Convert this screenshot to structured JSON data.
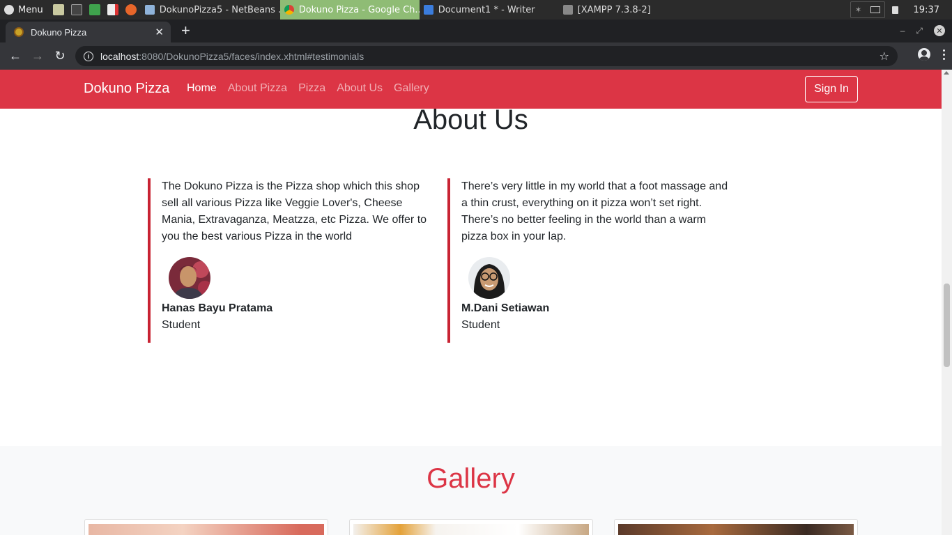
{
  "taskbar": {
    "menu_label": "Menu",
    "windows": [
      {
        "label": "DokunoPizza5 - NetBeans ...",
        "active": false
      },
      {
        "label": "Dokuno Pizza - Google Ch...",
        "active": true
      },
      {
        "label": "Document1 * - Writer",
        "active": false
      },
      {
        "label": "[XAMPP 7.3.8-2]",
        "active": false
      }
    ],
    "clock": "19:37"
  },
  "browser": {
    "tab_title": "Dokuno Pizza",
    "url_host": "localhost",
    "url_rest": ":8080/DokunoPizza5/faces/index.xhtml#testimonials"
  },
  "navbar": {
    "brand": "Dokuno Pizza",
    "links": [
      "Home",
      "About Pizza",
      "Pizza",
      "About Us",
      "Gallery"
    ],
    "sign_in": "Sign In"
  },
  "about": {
    "title": "About Us",
    "testimonials": [
      {
        "text": "The Dokuno Pizza is the Pizza shop which this shop sell all various Pizza like Veggie Lover's, Cheese Mania, Extravaganza, Meatzza, etc Pizza. We offer to you the best various Pizza in the world",
        "name": "Hanas Bayu Pratama",
        "role": "Student"
      },
      {
        "text": "There’s very little in my world that a foot massage and a thin crust, everything on it pizza won’t set right. There’s no better feeling in the world than a warm pizza box in your lap.",
        "name": "M.Dani Setiawan",
        "role": "Student"
      }
    ]
  },
  "gallery": {
    "title": "Gallery"
  },
  "colors": {
    "brand_red": "#dc3545",
    "border_red": "#c82333",
    "active_tab_green": "#8fbc75"
  }
}
